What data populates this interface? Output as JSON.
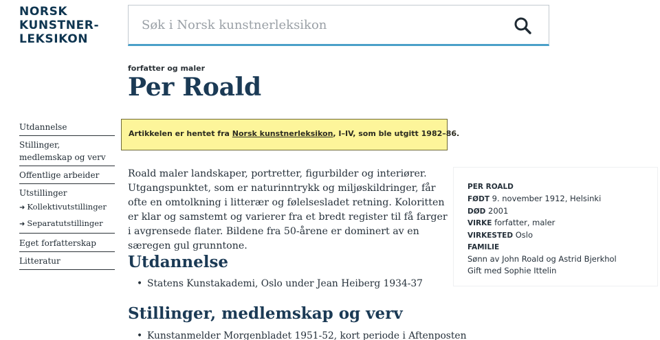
{
  "logo": {
    "line1": "NORSK",
    "line2": "KUNSTNER-",
    "line3": "LEKSIKON"
  },
  "search": {
    "placeholder": "Søk i Norsk kunstnerleksikon"
  },
  "article": {
    "eyebrow": "forfatter og maler",
    "title": "Per Roald",
    "notice_pre": "Artikkelen er hentet fra ",
    "notice_link": "Norsk kunstnerleksikon",
    "notice_post": ", I–IV, som ble utgitt 1982–86.",
    "intro": "Roald maler landskaper, portretter, figurbilder og interiører. Utgangspunktet, som er naturinntrykk og miljøskildringer, får ofte en omtolkning i litterær og følelsesladet retning. Koloritten er klar og samstemt og varierer fra et bredt register til få farger i avgrensede flater. Bildene fra 50-årene er dominert av en særegen gul grunntone.",
    "sections": [
      {
        "heading": "Utdannelse",
        "items": [
          "Statens Kunstakademi, Oslo under Jean Heiberg 1934-37"
        ]
      },
      {
        "heading": "Stillinger, medlemskap og verv",
        "items": [
          "Kunstanmelder Morgenbladet 1951-52, kort periode i Aftenposten"
        ]
      }
    ]
  },
  "toc": {
    "utdannelse": "Utdannelse",
    "stillinger_1": "Stillinger,",
    "stillinger_2": "medlemskap og verv",
    "offentlige": "Offentlige arbeider",
    "utstillinger": "Utstillinger",
    "kollektiv": "Kollektivutstillinger",
    "separat": "Separatutstillinger",
    "forfatterskap": "Eget forfatterskap",
    "litteratur": "Litteratur",
    "sub_arrow": "➜"
  },
  "facts": {
    "name": "PER ROALD",
    "fodt_label": "FØDT",
    "fodt_value": "9. november 1912, Helsinki",
    "dod_label": "DØD",
    "dod_value": "2001",
    "virke_label": "VIRKE",
    "virke_value": "forfatter, maler",
    "virkested_label": "VIRKESTED",
    "virkested_value": "Oslo",
    "familie_label": "FAMILIE",
    "familie_1": "Sønn av John Roald og Astrid Bjerkhol",
    "familie_2": "Gift med Sophie Ittelin"
  }
}
